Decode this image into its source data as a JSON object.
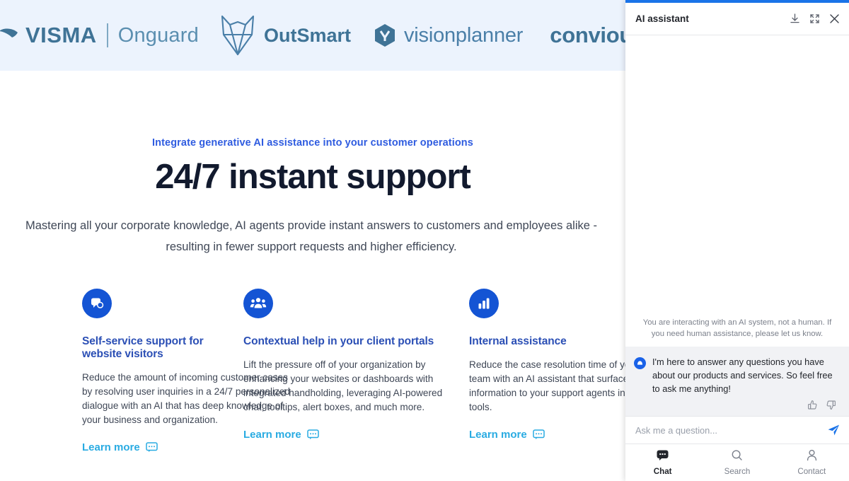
{
  "logos": [
    {
      "name": "visma-onguard",
      "word": "VISMA",
      "sub": "Onguard"
    },
    {
      "name": "outsmart",
      "word": "OutSmart"
    },
    {
      "name": "visionplanner",
      "word": "visionplanner"
    },
    {
      "name": "convious",
      "word": "convious"
    }
  ],
  "hero": {
    "eyebrow": "Integrate generative AI assistance into your customer operations",
    "headline": "24/7 instant support",
    "subhead": "Mastering all your corporate knowledge, AI agents provide instant answers to customers and employees alike - resulting in fewer support requests and higher efficiency."
  },
  "cards": [
    {
      "icon": "chat-bubbles-icon",
      "title": "Self-service support for website visitors",
      "body": "Reduce the amount of incoming customer cases by resolving user inquiries in a 24/7 personalized dialogue with an AI that has deep knowledge of your business and organization.",
      "link": "Learn more"
    },
    {
      "icon": "people-group-icon",
      "title": "Contextual help in your client portals",
      "body": "Lift the pressure off of your organization by enhancing your websites or dashboards with integrated handholding, leveraging AI-powered chat, tooltips, alert boxes, and much more.",
      "link": "Learn more"
    },
    {
      "icon": "bar-chart-icon",
      "title": "Internal assistance",
      "body": "Reduce the case resolution time of your support team with an AI assistant that surfaces complex information to your support agents in their favorite tools.",
      "link": "Learn more"
    }
  ],
  "panel": {
    "title": "AI assistant",
    "header_icons": [
      "download-icon",
      "expand-icon",
      "close-icon"
    ],
    "disclaimer": "You are interacting with an AI system, not a human. If you need human assistance, please let us know.",
    "message": "I'm here to answer any questions you have about our products and services. So feel free to ask me anything!",
    "feedback": [
      "thumbs-up-icon",
      "thumbs-down-icon"
    ],
    "input_placeholder": "Ask me a question...",
    "input_value": "",
    "send_icon": "send-icon",
    "nav": [
      {
        "label": "Chat",
        "icon": "chat-icon",
        "active": true
      },
      {
        "label": "Search",
        "icon": "search-icon",
        "active": false
      },
      {
        "label": "Contact",
        "icon": "person-icon",
        "active": false
      }
    ]
  },
  "colors": {
    "accent_blue": "#1a73e8",
    "brand_indigo": "#2b4fb5",
    "link_cyan": "#29abe2",
    "icon_blue": "#1454d4",
    "logo_blue": "#4a7fa8",
    "band_bg": "#ecf3fd"
  }
}
